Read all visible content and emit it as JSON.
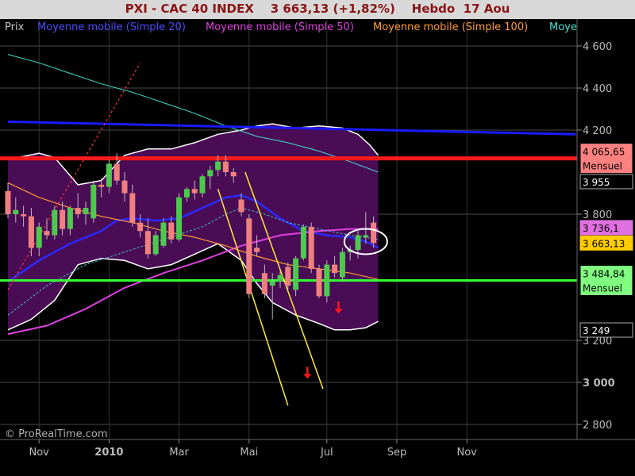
{
  "header": {
    "title": "PXI - CAC 40 INDEX    3 663,13 (+1,82%)    Hebdo  17 Aou"
  },
  "legend": [
    {
      "label": "Prix",
      "color": "#c8c8c8"
    },
    {
      "label": "Moyenne mobile (Simple 20)",
      "color": "#4b4bff"
    },
    {
      "label": "Moyenne mobile (Simple 50)",
      "color": "#e040e0"
    },
    {
      "label": "Moyenne mobile (Simple 100)",
      "color": "#ff9a33"
    },
    {
      "label": "Moye",
      "color": "#40e0d0"
    }
  ],
  "watermark": "© ProRealTime.com",
  "colors": {
    "background": "#000000",
    "bollinger_fill": "#4a0c55",
    "bollinger_edge": "#ffffff",
    "bull_candle": "#4ec94e",
    "bear_candle": "#f08080",
    "grid": "#4a4a4a",
    "resistance": "#ff1a1a",
    "support": "#33ff33",
    "trend_blue": "#1a1aff",
    "trend_yellow": "#ffee33",
    "trend_red_dashed": "#ff3333",
    "arrow": "#ff1a1a",
    "circle": "#ffffff"
  },
  "chart_data": {
    "type": "candlestick",
    "timeframe": "weekly",
    "ylim": [
      2750,
      4700
    ],
    "y_ticks": [
      {
        "value": 4600,
        "label": "4 600"
      },
      {
        "value": 4400,
        "label": "4 400"
      },
      {
        "value": 4200,
        "label": "4 200"
      },
      {
        "value": 3800,
        "label": "3 800"
      },
      {
        "value": 3200,
        "label": "3 200"
      },
      {
        "value": 3000,
        "label": "3 000"
      },
      {
        "value": 2800,
        "label": "2 800"
      }
    ],
    "x_ticks": [
      {
        "index": 4,
        "label": "Nov"
      },
      {
        "index": 13,
        "label": "2010"
      },
      {
        "index": 22,
        "label": "Mar"
      },
      {
        "index": 31,
        "label": "Mai"
      },
      {
        "index": 41,
        "label": "Jul"
      },
      {
        "index": 50,
        "label": "Sep"
      },
      {
        "index": 59,
        "label": "Nov"
      }
    ],
    "candles": [
      {
        "o": 3910,
        "h": 3950,
        "l": 3780,
        "c": 3800
      },
      {
        "o": 3800,
        "h": 3880,
        "l": 3760,
        "c": 3820
      },
      {
        "o": 3800,
        "h": 3840,
        "l": 3740,
        "c": 3790
      },
      {
        "o": 3790,
        "h": 3830,
        "l": 3600,
        "c": 3640
      },
      {
        "o": 3640,
        "h": 3760,
        "l": 3600,
        "c": 3740
      },
      {
        "o": 3720,
        "h": 3780,
        "l": 3680,
        "c": 3700
      },
      {
        "o": 3700,
        "h": 3840,
        "l": 3680,
        "c": 3820
      },
      {
        "o": 3820,
        "h": 3860,
        "l": 3700,
        "c": 3730
      },
      {
        "o": 3730,
        "h": 3840,
        "l": 3700,
        "c": 3830
      },
      {
        "o": 3830,
        "h": 3900,
        "l": 3780,
        "c": 3800
      },
      {
        "o": 3800,
        "h": 3860,
        "l": 3750,
        "c": 3830
      },
      {
        "o": 3780,
        "h": 3960,
        "l": 3760,
        "c": 3940
      },
      {
        "o": 3940,
        "h": 3970,
        "l": 3880,
        "c": 3930
      },
      {
        "o": 3930,
        "h": 4060,
        "l": 3900,
        "c": 4040
      },
      {
        "o": 4040,
        "h": 4090,
        "l": 3940,
        "c": 3960
      },
      {
        "o": 3960,
        "h": 4000,
        "l": 3860,
        "c": 3900
      },
      {
        "o": 3900,
        "h": 3940,
        "l": 3740,
        "c": 3760
      },
      {
        "o": 3760,
        "h": 3800,
        "l": 3690,
        "c": 3720
      },
      {
        "o": 3720,
        "h": 3780,
        "l": 3590,
        "c": 3610
      },
      {
        "o": 3610,
        "h": 3720,
        "l": 3600,
        "c": 3700
      },
      {
        "o": 3650,
        "h": 3780,
        "l": 3640,
        "c": 3760
      },
      {
        "o": 3760,
        "h": 3790,
        "l": 3660,
        "c": 3680
      },
      {
        "o": 3680,
        "h": 3900,
        "l": 3670,
        "c": 3880
      },
      {
        "o": 3880,
        "h": 3930,
        "l": 3860,
        "c": 3920
      },
      {
        "o": 3920,
        "h": 3960,
        "l": 3870,
        "c": 3900
      },
      {
        "o": 3900,
        "h": 3990,
        "l": 3880,
        "c": 3980
      },
      {
        "o": 3980,
        "h": 4030,
        "l": 3920,
        "c": 4010
      },
      {
        "o": 4010,
        "h": 4080,
        "l": 3980,
        "c": 4050
      },
      {
        "o": 4050,
        "h": 4080,
        "l": 3980,
        "c": 4000
      },
      {
        "o": 4000,
        "h": 4020,
        "l": 3950,
        "c": 3980
      },
      {
        "o": 3870,
        "h": 3900,
        "l": 3790,
        "c": 3810
      },
      {
        "o": 3780,
        "h": 3800,
        "l": 3400,
        "c": 3420
      },
      {
        "o": 3640,
        "h": 3700,
        "l": 3600,
        "c": 3620
      },
      {
        "o": 3520,
        "h": 3560,
        "l": 3400,
        "c": 3420
      },
      {
        "o": 3460,
        "h": 3520,
        "l": 3300,
        "c": 3480
      },
      {
        "o": 3480,
        "h": 3530,
        "l": 3450,
        "c": 3510
      },
      {
        "o": 3550,
        "h": 3570,
        "l": 3440,
        "c": 3460
      },
      {
        "o": 3440,
        "h": 3600,
        "l": 3410,
        "c": 3590
      },
      {
        "o": 3590,
        "h": 3750,
        "l": 3580,
        "c": 3740
      },
      {
        "o": 3740,
        "h": 3760,
        "l": 3520,
        "c": 3540
      },
      {
        "o": 3540,
        "h": 3560,
        "l": 3400,
        "c": 3410
      },
      {
        "o": 3410,
        "h": 3580,
        "l": 3380,
        "c": 3560
      },
      {
        "o": 3560,
        "h": 3600,
        "l": 3500,
        "c": 3520
      },
      {
        "o": 3500,
        "h": 3640,
        "l": 3480,
        "c": 3620
      },
      {
        "o": 3620,
        "h": 3650,
        "l": 3580,
        "c": 3630
      },
      {
        "o": 3630,
        "h": 3720,
        "l": 3590,
        "c": 3700
      },
      {
        "o": 3690,
        "h": 3810,
        "l": 3660,
        "c": 3700
      },
      {
        "o": 3760,
        "h": 3790,
        "l": 3640,
        "c": 3663
      }
    ],
    "series": [
      {
        "name": "Moyenne mobile (Simple 20)",
        "color": "#2a2aff",
        "width": 2.5,
        "points": [
          [
            0,
            3480
          ],
          [
            4,
            3580
          ],
          [
            8,
            3660
          ],
          [
            12,
            3720
          ],
          [
            14,
            3770
          ],
          [
            16,
            3780
          ],
          [
            19,
            3770
          ],
          [
            22,
            3780
          ],
          [
            25,
            3830
          ],
          [
            28,
            3880
          ],
          [
            30,
            3890
          ],
          [
            32,
            3860
          ],
          [
            35,
            3780
          ],
          [
            38,
            3720
          ],
          [
            41,
            3700
          ],
          [
            44,
            3690
          ],
          [
            46,
            3670
          ],
          [
            47.6,
            3640
          ]
        ]
      },
      {
        "name": "Moyenne mobile (Simple 50)",
        "color": "#e040e0",
        "width": 2,
        "points": [
          [
            0,
            3230
          ],
          [
            5,
            3270
          ],
          [
            10,
            3350
          ],
          [
            15,
            3450
          ],
          [
            20,
            3520
          ],
          [
            25,
            3580
          ],
          [
            30,
            3650
          ],
          [
            35,
            3700
          ],
          [
            40,
            3720
          ],
          [
            44,
            3730
          ],
          [
            47.6,
            3730
          ]
        ]
      },
      {
        "name": "Moyenne mobile (Simple 100)",
        "color": "#ff9a33",
        "width": 1.2,
        "points": [
          [
            0,
            3950
          ],
          [
            4,
            3880
          ],
          [
            8,
            3830
          ],
          [
            12,
            3790
          ],
          [
            16,
            3760
          ],
          [
            20,
            3720
          ],
          [
            24,
            3690
          ],
          [
            28,
            3650
          ],
          [
            32,
            3600
          ],
          [
            36,
            3560
          ],
          [
            40,
            3540
          ],
          [
            44,
            3520
          ],
          [
            47.6,
            3490
          ]
        ]
      },
      {
        "name": "Moye",
        "color": "#40e0d0",
        "width": 1,
        "points": [
          [
            0,
            4560
          ],
          [
            4,
            4520
          ],
          [
            8,
            4470
          ],
          [
            12,
            4420
          ],
          [
            16,
            4380
          ],
          [
            20,
            4330
          ],
          [
            24,
            4280
          ],
          [
            28,
            4220
          ],
          [
            32,
            4170
          ],
          [
            36,
            4140
          ],
          [
            40,
            4100
          ],
          [
            44,
            4050
          ],
          [
            47.6,
            4000
          ]
        ]
      },
      {
        "name": "ma-cyan-dashed",
        "color": "#40c0d0",
        "width": 1,
        "dash": "3,2",
        "points": [
          [
            0,
            3320
          ],
          [
            5,
            3460
          ],
          [
            10,
            3560
          ],
          [
            15,
            3620
          ],
          [
            20,
            3680
          ],
          [
            25,
            3740
          ],
          [
            28,
            3800
          ],
          [
            30,
            3830
          ],
          [
            33,
            3800
          ],
          [
            36,
            3760
          ],
          [
            40,
            3730
          ],
          [
            44,
            3700
          ],
          [
            47.6,
            3680
          ]
        ]
      }
    ],
    "bollinger": {
      "upper": [
        [
          0,
          4060
        ],
        [
          4,
          4090
        ],
        [
          6,
          4070
        ],
        [
          9,
          3940
        ],
        [
          12,
          3960
        ],
        [
          15,
          4080
        ],
        [
          18,
          4110
        ],
        [
          21,
          4110
        ],
        [
          24,
          4140
        ],
        [
          27,
          4180
        ],
        [
          30,
          4200
        ],
        [
          32,
          4220
        ],
        [
          34,
          4230
        ],
        [
          37,
          4210
        ],
        [
          40,
          4220
        ],
        [
          43,
          4210
        ],
        [
          45,
          4180
        ],
        [
          46.5,
          4130
        ],
        [
          47.6,
          4080
        ]
      ],
      "lower": [
        [
          0,
          3250
        ],
        [
          3,
          3300
        ],
        [
          6,
          3390
        ],
        [
          9,
          3560
        ],
        [
          12,
          3590
        ],
        [
          15,
          3580
        ],
        [
          18,
          3540
        ],
        [
          21,
          3560
        ],
        [
          24,
          3610
        ],
        [
          27,
          3660
        ],
        [
          30,
          3580
        ],
        [
          32,
          3470
        ],
        [
          34,
          3380
        ],
        [
          37,
          3320
        ],
        [
          40,
          3280
        ],
        [
          42,
          3250
        ],
        [
          44,
          3250
        ],
        [
          46,
          3260
        ],
        [
          47.6,
          3290
        ]
      ]
    },
    "horizontal_levels": [
      {
        "value": 4065.65,
        "color": "#ff1a1a",
        "label": "4 065,65",
        "sublabel": "Mensuel"
      },
      {
        "value": 3484.84,
        "color": "#33ff33",
        "label": "3 484,84",
        "sublabel": "Mensuel"
      }
    ],
    "value_tags": [
      {
        "value": 3955,
        "label": "3 955"
      },
      {
        "value": 3736.1,
        "label": "3 736,1"
      },
      {
        "value": 3663.13,
        "label": "3 663,13"
      },
      {
        "value": 3249,
        "label": "3 249"
      }
    ],
    "trend_lines": [
      {
        "color": "#1a1aff",
        "width": 3,
        "from": [
          0,
          4240
        ],
        "to": [
          73,
          4180
        ]
      },
      {
        "color": "#ffee33",
        "width": 1.5,
        "from": [
          27,
          3920
        ],
        "to": [
          36,
          2890
        ]
      },
      {
        "color": "#ffee33",
        "width": 1.5,
        "from": [
          30.5,
          4000
        ],
        "to": [
          40.5,
          2970
        ]
      },
      {
        "color": "#ff3333",
        "width": 1.2,
        "dash": "3,3",
        "from": [
          0,
          3440
        ],
        "to": [
          17,
          4520
        ]
      }
    ],
    "arrows": [
      {
        "index": 38.5,
        "value": 3040,
        "color": "#ff1a1a"
      },
      {
        "index": 42.5,
        "value": 3350,
        "color": "#ff1a1a"
      }
    ],
    "circle": {
      "index": 46,
      "value": 3670,
      "rx": 27,
      "ry": 16
    }
  }
}
